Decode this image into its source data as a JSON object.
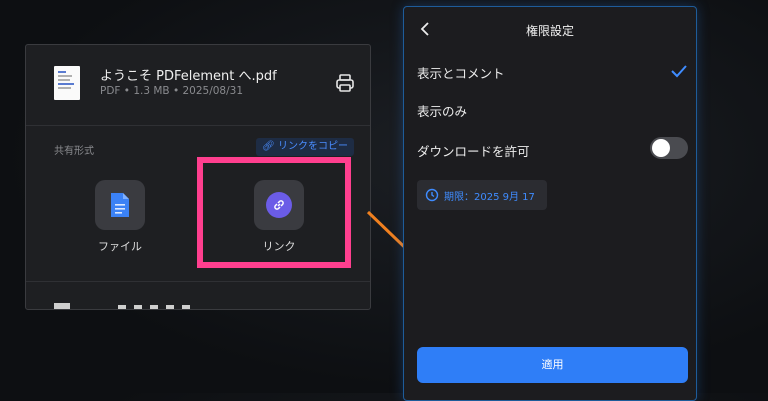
{
  "share": {
    "file_name": "ようこそ PDFelement へ.pdf",
    "file_meta": "PDF • 1.3 MB • 2025/08/31",
    "section_label": "共有形式",
    "copy_link_label": "リンクをコピー",
    "options": [
      {
        "label": "ファイル",
        "icon": "file-icon"
      },
      {
        "label": "リンク",
        "icon": "link-icon"
      }
    ]
  },
  "permissions": {
    "title": "権限設定",
    "items": [
      {
        "label": "表示とコメント",
        "selected": true
      },
      {
        "label": "表示のみ",
        "selected": false
      }
    ],
    "download_label": "ダウンロードを許可",
    "download_enabled": false,
    "expiry_label": "期限：2025 9月 17",
    "apply_label": "適用"
  },
  "colors": {
    "highlight": "#ff3f8f",
    "arrow": "#f0801f",
    "accent": "#2f7ef7"
  }
}
